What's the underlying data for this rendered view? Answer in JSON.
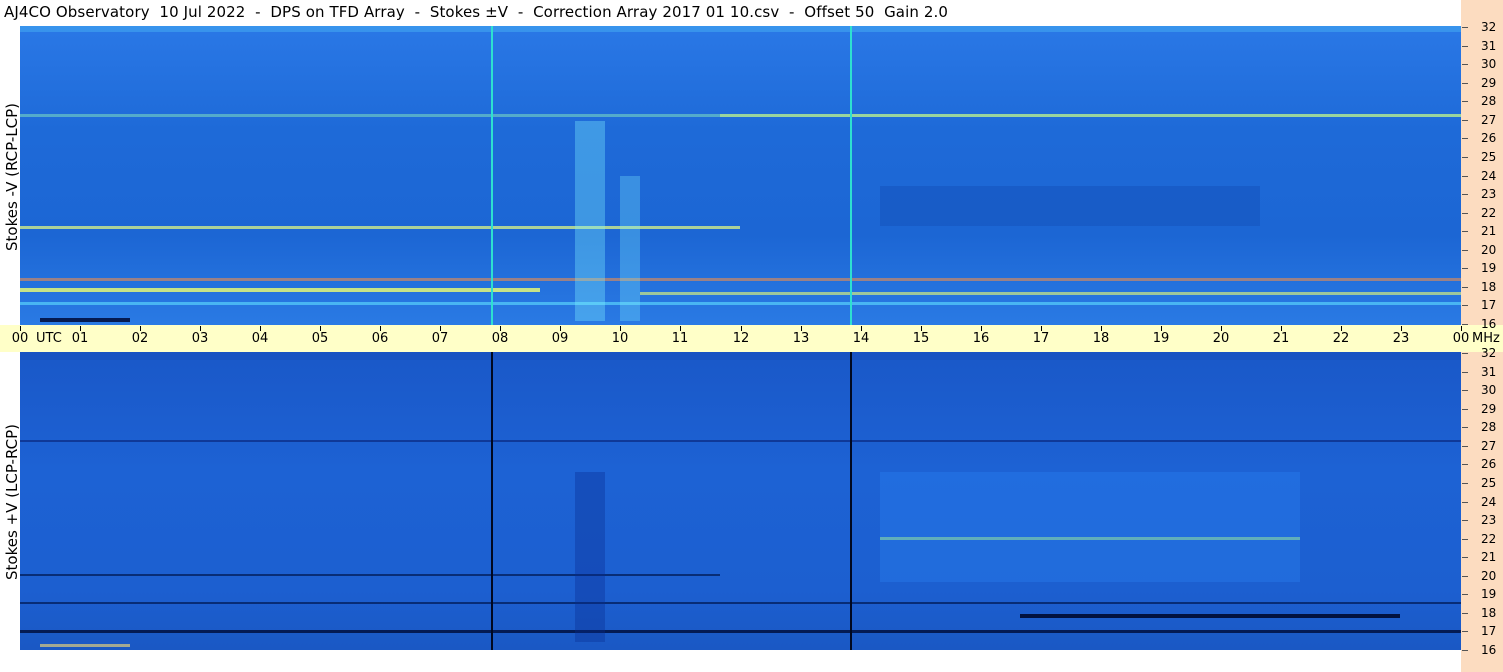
{
  "title": "AJ4CO Observatory  10 Jul 2022  -  DPS on TFD Array  -  Stokes ±V  -  Correction Array 2017 01 10.csv  -  Offset 50  Gain 2.0",
  "panels": {
    "top": {
      "label": "Stokes -V (RCP-LCP)",
      "marker_color": "#2ee0d0"
    },
    "bottom": {
      "label": "Stokes +V (LCP-RCP)",
      "marker_color": "#000820"
    }
  },
  "time_axis": {
    "hours": [
      "00",
      "01",
      "02",
      "03",
      "04",
      "05",
      "06",
      "07",
      "08",
      "09",
      "10",
      "11",
      "12",
      "13",
      "14",
      "15",
      "16",
      "17",
      "18",
      "19",
      "20",
      "21",
      "22",
      "23",
      "00"
    ],
    "utc_label": "UTC",
    "mhz_label": "MHz"
  },
  "freq_axis": {
    "labels": [
      "32",
      "31",
      "30",
      "29",
      "28",
      "27",
      "26",
      "25",
      "24",
      "23",
      "22",
      "21",
      "20",
      "19",
      "18",
      "17",
      "16"
    ]
  },
  "colors": {
    "background_blue": "#1f6fe0",
    "time_axis_bg": "#ffffc8",
    "freq_axis_bg": "#fcdcc0"
  }
}
